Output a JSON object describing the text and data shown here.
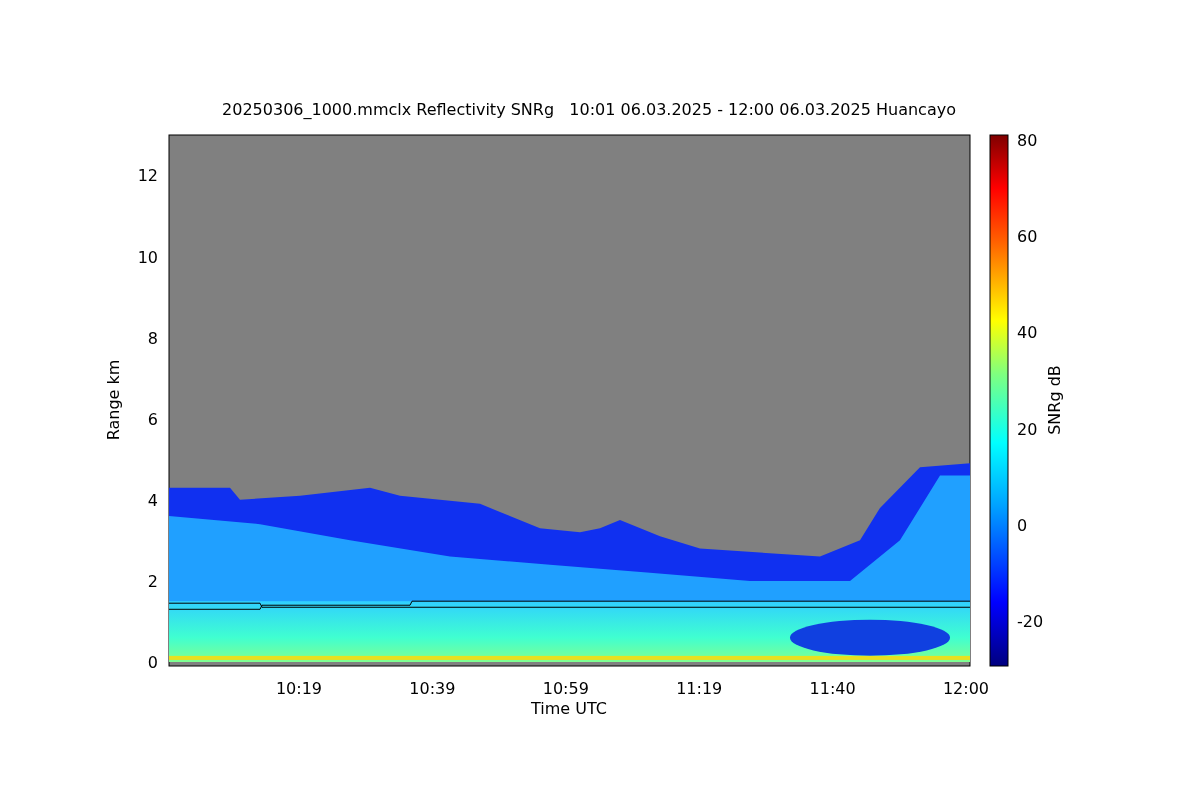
{
  "title": "20250306_1000.mmclx Reflectivity SNRg   10:01 06.03.2025 - 12:00 06.03.2025 Huancayo",
  "y_axis": {
    "label": "Range km",
    "ticks": [
      "12",
      "10",
      "8",
      "6",
      "4",
      "2",
      "0"
    ]
  },
  "x_axis": {
    "label": "Time UTC",
    "ticks": [
      "10:19",
      "10:39",
      "10:59",
      "11:19",
      "11:40",
      "12:00"
    ]
  },
  "colorbar": {
    "label": "SNRg dB",
    "ticks": [
      "80",
      "60",
      "40",
      "20",
      "0",
      "-20"
    ]
  }
}
